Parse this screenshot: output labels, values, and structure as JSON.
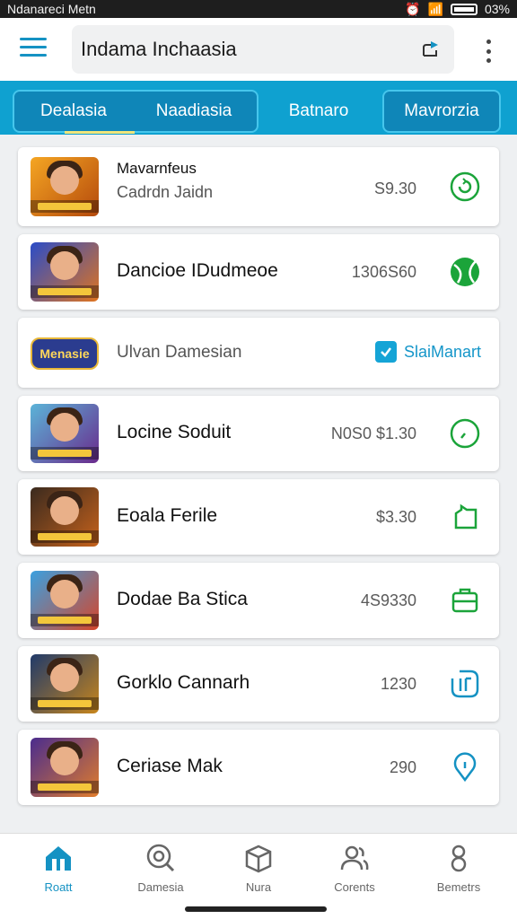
{
  "status_bar": {
    "left_text": "Ndanareci Metn",
    "battery_text": "03%"
  },
  "app_bar": {
    "search_text": "Indama Inchaasia"
  },
  "tabs": [
    {
      "label": "Dealasia"
    },
    {
      "label": "Naadiasia"
    },
    {
      "label": "Batnaro"
    },
    {
      "label": "Mavrorzia"
    }
  ],
  "items": [
    {
      "title": "Mavarnfeus",
      "subtitle": "Cadrdn Jaidn",
      "price": "S9.30",
      "action_icon": "refresh-circle-icon"
    },
    {
      "title": "Dancioe IDudmeoe",
      "price": "1306S60",
      "action_icon": "tennis-ball-icon"
    },
    {
      "title": "Ulvan Damesian",
      "logo_text": "Menasie",
      "check_label": "SlaiManart"
    },
    {
      "title": "Locine Soduit",
      "price": "N0S0 $1.30",
      "action_icon": "timer-icon"
    },
    {
      "title": "Eoala Ferile",
      "price": "$3.30",
      "action_icon": "hand-icon"
    },
    {
      "title": "Dodae Ba Stica",
      "price": "4S9330",
      "action_icon": "briefcase-icon"
    },
    {
      "title": "Gorklo Cannarh",
      "price": "1230",
      "action_icon": "bracket-icon"
    },
    {
      "title": "Ceriase Mak",
      "price": "290",
      "action_icon": "location-icon"
    }
  ],
  "bottom_nav": [
    {
      "label": "Roatt",
      "icon": "home-icon"
    },
    {
      "label": "Damesia",
      "icon": "search-icon"
    },
    {
      "label": "Nura",
      "icon": "box-icon"
    },
    {
      "label": "Corents",
      "icon": "people-icon"
    },
    {
      "label": "Bemetrs",
      "icon": "user-icon"
    }
  ],
  "colors": {
    "accent": "#1592c3",
    "tab_bar": "#0fa1d0",
    "action_green": "#1ba43a"
  }
}
